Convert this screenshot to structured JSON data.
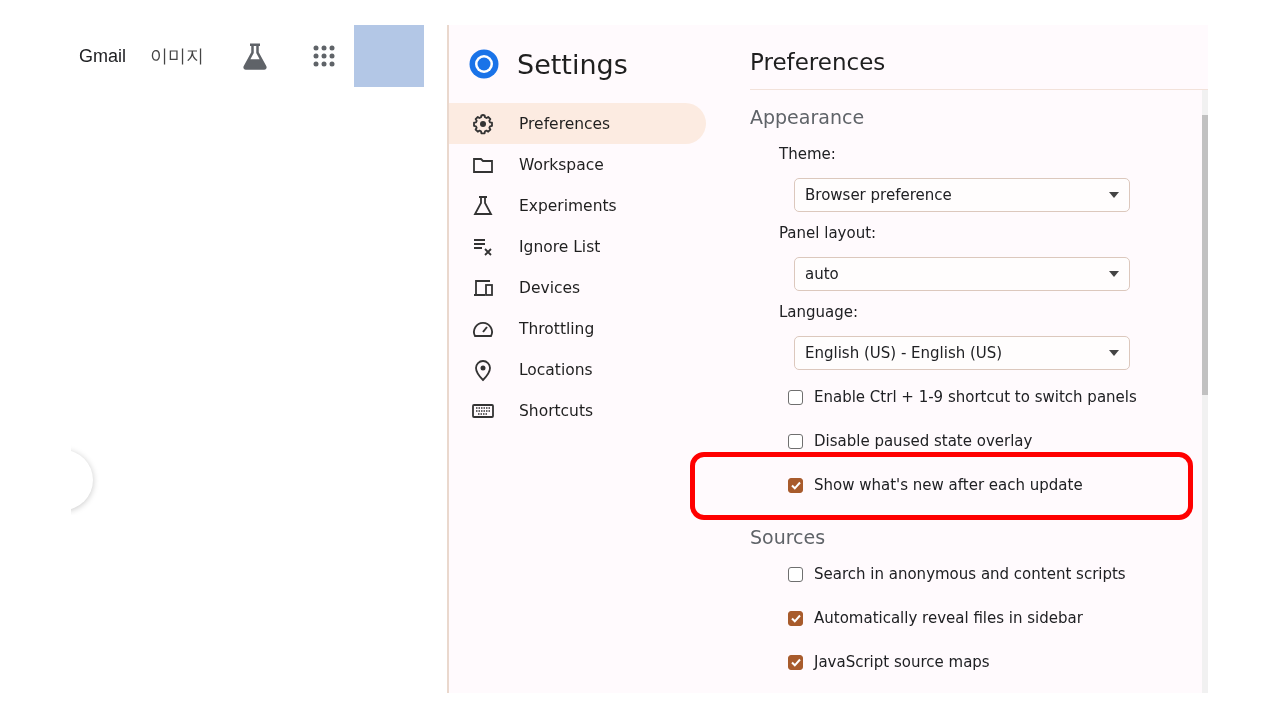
{
  "google_bar": {
    "links": [
      "Gmail",
      "이미지"
    ]
  },
  "settings": {
    "title": "Settings",
    "nav": [
      {
        "label": "Preferences",
        "selected": true
      },
      {
        "label": "Workspace",
        "selected": false
      },
      {
        "label": "Experiments",
        "selected": false
      },
      {
        "label": "Ignore List",
        "selected": false
      },
      {
        "label": "Devices",
        "selected": false
      },
      {
        "label": "Throttling",
        "selected": false
      },
      {
        "label": "Locations",
        "selected": false
      },
      {
        "label": "Shortcuts",
        "selected": false
      }
    ]
  },
  "panel": {
    "title": "Preferences",
    "sections": [
      {
        "title": "Appearance",
        "items": [
          {
            "kind": "select",
            "label": "Theme:",
            "value": "Browser preference",
            "highlighted": false
          },
          {
            "kind": "select",
            "label": "Panel layout:",
            "value": "auto",
            "highlighted": false
          },
          {
            "kind": "select",
            "label": "Language:",
            "value": "English (US) - English (US)",
            "highlighted": false
          },
          {
            "kind": "checkbox",
            "label": "Enable Ctrl + 1-9 shortcut to switch panels",
            "checked": false,
            "highlighted": false
          },
          {
            "kind": "checkbox",
            "label": "Disable paused state overlay",
            "checked": false,
            "highlighted": false
          },
          {
            "kind": "checkbox",
            "label": "Show what's new after each update",
            "checked": true,
            "highlighted": true
          }
        ]
      },
      {
        "title": "Sources",
        "items": [
          {
            "kind": "checkbox",
            "label": "Search in anonymous and content scripts",
            "checked": false,
            "highlighted": false
          },
          {
            "kind": "checkbox",
            "label": "Automatically reveal files in sidebar",
            "checked": true,
            "highlighted": false
          },
          {
            "kind": "checkbox",
            "label": "JavaScript source maps",
            "checked": true,
            "highlighted": false
          }
        ]
      }
    ]
  }
}
